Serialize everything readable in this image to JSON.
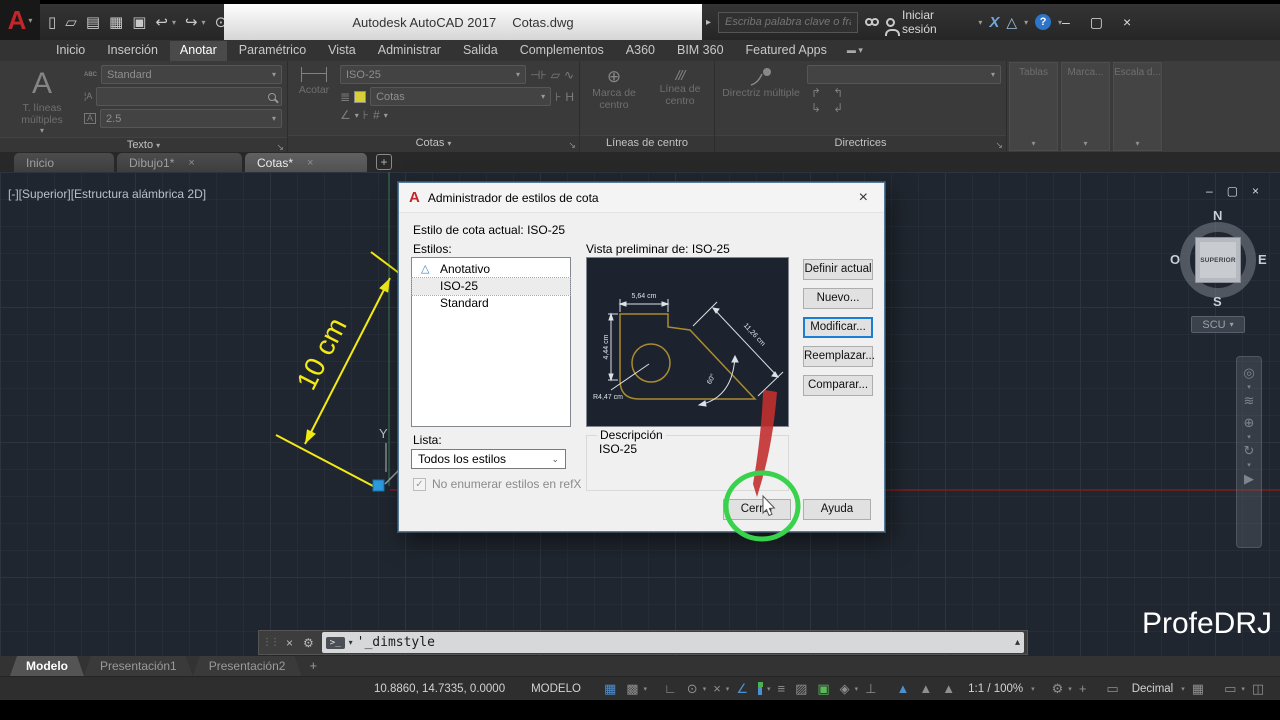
{
  "titlebar": {
    "title_app": "Autodesk AutoCAD 2017",
    "title_doc": "Cotas.dwg",
    "search_placeholder": "Escriba palabra clave o frase",
    "signin": "Iniciar sesión"
  },
  "icons": {
    "logo_a": "A",
    "qat_new": "▯",
    "qat_open": "▱",
    "qat_save": "▤",
    "qat_saveas": "▦",
    "qat_plot": "▣",
    "qat_undo": "↩",
    "qat_redo": "↪",
    "qat_workspace": "⊙",
    "search_arrow": "▸",
    "exchange_x": "X",
    "a360_tri": "△",
    "help_q": "?",
    "win_min": "–",
    "win_restore": "▢",
    "win_close": "×",
    "tab_close": "×",
    "tab_add": "+",
    "launcher": "↘",
    "dd": "▾",
    "cmd_close": "×",
    "cmd_wrench": "⚙",
    "cmd_prompt": ">_",
    "cmd_up": "▴",
    "cmd_grip": "⋮⋮"
  },
  "ribbon_tabs": [
    "Inicio",
    "Inserción",
    "Anotar",
    "Paramétrico",
    "Vista",
    "Administrar",
    "Salida",
    "Complementos",
    "A360",
    "BIM 360",
    "Featured Apps"
  ],
  "ribbon": {
    "texto": {
      "panel_label": "Texto",
      "big_label": "T. líneas múltiples",
      "abc": "ABC",
      "style_value": "Standard",
      "height_value": "2.5"
    },
    "cotas": {
      "panel_label": "Cotas",
      "acotar": "Acotar",
      "style_value": "ISO-25",
      "layer_value": "Cotas"
    },
    "lineas": {
      "panel_label": "Líneas de centro",
      "marca": "Marca de centro",
      "linea": "Línea de centro"
    },
    "directrices": {
      "panel_label": "Directrices",
      "big_label": "Directriz múltiple"
    },
    "collapsed": [
      "Tablas",
      "Marca...",
      "Escala d..."
    ]
  },
  "file_tabs": [
    "Inicio",
    "Dibujo1*",
    "Cotas*"
  ],
  "viewport": {
    "label": "[-][Superior][Estructura alámbrica 2D]",
    "dimension_text": "10 cm",
    "axis_label": "Y",
    "viewcube": {
      "north": "N",
      "south": "S",
      "east": "E",
      "west": "O",
      "face": "SUPERIOR",
      "scu": "SCU"
    },
    "watermark": "ProfeDRJ"
  },
  "dialog": {
    "title": "Administrador de estilos de cota",
    "current_style_label": "Estilo de cota actual: ISO-25",
    "styles_label": "Estilos:",
    "styles": [
      "Anotativo",
      "ISO-25",
      "Standard"
    ],
    "preview_label": "Vista preliminar de: ISO-25",
    "preview": {
      "dim_top": "5,64 cm",
      "dim_left": "4,44 cm",
      "dim_aligned": "11,26 cm",
      "dim_angle": "60°",
      "dim_radius": "R4,47 cm"
    },
    "buttons": {
      "definir": "Definir actual",
      "nuevo": "Nuevo...",
      "modificar": "Modificar...",
      "reemplazar": "Reemplazar...",
      "comparar": "Comparar...",
      "cerrar": "Cerrar",
      "ayuda": "Ayuda"
    },
    "lista_label": "Lista:",
    "lista_value": "Todos los estilos",
    "checkbox_label": "No enumerar estilos en refX",
    "checkbox_mark": "✓",
    "descripcion_label": "Descripción",
    "descripcion_value": "ISO-25"
  },
  "command_line": {
    "value": "'_dimstyle"
  },
  "layout_tabs": [
    "Modelo",
    "Presentación1",
    "Presentación2"
  ],
  "status_bar": {
    "coordinates": "10.8860, 14.7335, 0.0000",
    "space_label": "MODELO",
    "annotation_scale": "1:1 / 100%",
    "units": "Decimal"
  },
  "status_icons": {
    "grid": "▦",
    "snap": "▩",
    "ortho": "∟",
    "polar": "⊙",
    "iso": "×",
    "otrack": "∠",
    "lineweight": "≡",
    "transparency": "▨",
    "cycling": "▣",
    "osnap3d": "◈",
    "ducs": "⊥",
    "annot_vis": "▲",
    "autoscale": "▲",
    "scale_person": "▲",
    "gear": "⚙",
    "plus": "+",
    "ruler": "▭",
    "calc": "▦",
    "monitor": "▭",
    "graphics": "◫",
    "isolate": "▧",
    "fullscreen": "⊞",
    "menu": "≡"
  }
}
